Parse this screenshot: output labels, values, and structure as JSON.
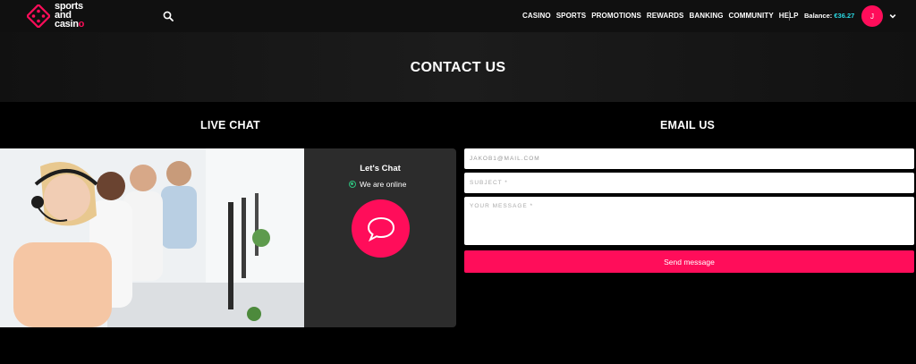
{
  "header": {
    "logo_lines": [
      "sports",
      "and",
      "casino"
    ],
    "nav": [
      "CASINO",
      "SPORTS",
      "PROMOTIONS",
      "REWARDS",
      "BANKING",
      "COMMUNITY",
      "HELP"
    ],
    "balance_label": "Balance:",
    "balance_value": "€36.27",
    "avatar_initial": "J"
  },
  "hero": {
    "title": "CONTACT US"
  },
  "live_chat": {
    "title": "LIVE CHAT",
    "box_title": "Let's Chat",
    "status": "We are online"
  },
  "email_us": {
    "title": "EMAIL US",
    "email_value": "JAKOB1@MAIL.COM",
    "subject_placeholder": "SUBJECT *",
    "message_placeholder": "YOUR MESSAGE *",
    "send_label": "Send message"
  },
  "colors": {
    "accent": "#ff0d5a",
    "balance": "#2ad6e0",
    "online": "#2ec27e"
  }
}
